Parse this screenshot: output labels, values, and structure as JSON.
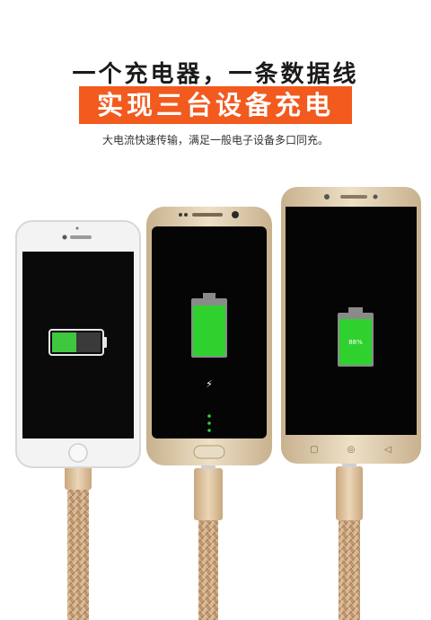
{
  "headline": "一个充电器，一条数据线",
  "banner": "实现三台设备充电",
  "subtitle": "大电流快速传输，满足一般电子设备多口同充。",
  "devices": {
    "right_battery_percent": "88%"
  },
  "colors": {
    "banner_bg": "#f25a1e",
    "battery_green": "#2fd12f",
    "cable_gold": "#d9b48c"
  }
}
